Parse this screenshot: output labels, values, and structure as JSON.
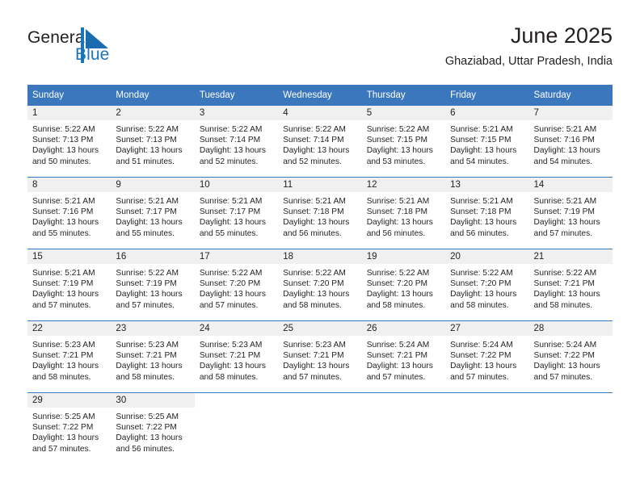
{
  "brand": {
    "name_part1": "General",
    "name_part2": "Blue",
    "flag_icon": "blue-flag-triangle-icon",
    "color_primary": "#1b75bb",
    "color_text": "#231f20"
  },
  "header": {
    "title": "June 2025",
    "subtitle": "Ghaziabad, Uttar Pradesh, India"
  },
  "theme": {
    "header_bg": "#3b77bc",
    "header_text": "#ffffff",
    "daynum_band_bg": "#f0f0f0",
    "cell_bg": "#ffffff",
    "row_separator": "#3b77bc"
  },
  "weekdays": [
    "Sunday",
    "Monday",
    "Tuesday",
    "Wednesday",
    "Thursday",
    "Friday",
    "Saturday"
  ],
  "weeks": [
    [
      {
        "day": "1",
        "sunrise": "Sunrise: 5:22 AM",
        "sunset": "Sunset: 7:13 PM",
        "daylight_line1": "Daylight: 13 hours",
        "daylight_line2": "and 50 minutes."
      },
      {
        "day": "2",
        "sunrise": "Sunrise: 5:22 AM",
        "sunset": "Sunset: 7:13 PM",
        "daylight_line1": "Daylight: 13 hours",
        "daylight_line2": "and 51 minutes."
      },
      {
        "day": "3",
        "sunrise": "Sunrise: 5:22 AM",
        "sunset": "Sunset: 7:14 PM",
        "daylight_line1": "Daylight: 13 hours",
        "daylight_line2": "and 52 minutes."
      },
      {
        "day": "4",
        "sunrise": "Sunrise: 5:22 AM",
        "sunset": "Sunset: 7:14 PM",
        "daylight_line1": "Daylight: 13 hours",
        "daylight_line2": "and 52 minutes."
      },
      {
        "day": "5",
        "sunrise": "Sunrise: 5:22 AM",
        "sunset": "Sunset: 7:15 PM",
        "daylight_line1": "Daylight: 13 hours",
        "daylight_line2": "and 53 minutes."
      },
      {
        "day": "6",
        "sunrise": "Sunrise: 5:21 AM",
        "sunset": "Sunset: 7:15 PM",
        "daylight_line1": "Daylight: 13 hours",
        "daylight_line2": "and 54 minutes."
      },
      {
        "day": "7",
        "sunrise": "Sunrise: 5:21 AM",
        "sunset": "Sunset: 7:16 PM",
        "daylight_line1": "Daylight: 13 hours",
        "daylight_line2": "and 54 minutes."
      }
    ],
    [
      {
        "day": "8",
        "sunrise": "Sunrise: 5:21 AM",
        "sunset": "Sunset: 7:16 PM",
        "daylight_line1": "Daylight: 13 hours",
        "daylight_line2": "and 55 minutes."
      },
      {
        "day": "9",
        "sunrise": "Sunrise: 5:21 AM",
        "sunset": "Sunset: 7:17 PM",
        "daylight_line1": "Daylight: 13 hours",
        "daylight_line2": "and 55 minutes."
      },
      {
        "day": "10",
        "sunrise": "Sunrise: 5:21 AM",
        "sunset": "Sunset: 7:17 PM",
        "daylight_line1": "Daylight: 13 hours",
        "daylight_line2": "and 55 minutes."
      },
      {
        "day": "11",
        "sunrise": "Sunrise: 5:21 AM",
        "sunset": "Sunset: 7:18 PM",
        "daylight_line1": "Daylight: 13 hours",
        "daylight_line2": "and 56 minutes."
      },
      {
        "day": "12",
        "sunrise": "Sunrise: 5:21 AM",
        "sunset": "Sunset: 7:18 PM",
        "daylight_line1": "Daylight: 13 hours",
        "daylight_line2": "and 56 minutes."
      },
      {
        "day": "13",
        "sunrise": "Sunrise: 5:21 AM",
        "sunset": "Sunset: 7:18 PM",
        "daylight_line1": "Daylight: 13 hours",
        "daylight_line2": "and 56 minutes."
      },
      {
        "day": "14",
        "sunrise": "Sunrise: 5:21 AM",
        "sunset": "Sunset: 7:19 PM",
        "daylight_line1": "Daylight: 13 hours",
        "daylight_line2": "and 57 minutes."
      }
    ],
    [
      {
        "day": "15",
        "sunrise": "Sunrise: 5:21 AM",
        "sunset": "Sunset: 7:19 PM",
        "daylight_line1": "Daylight: 13 hours",
        "daylight_line2": "and 57 minutes."
      },
      {
        "day": "16",
        "sunrise": "Sunrise: 5:22 AM",
        "sunset": "Sunset: 7:19 PM",
        "daylight_line1": "Daylight: 13 hours",
        "daylight_line2": "and 57 minutes."
      },
      {
        "day": "17",
        "sunrise": "Sunrise: 5:22 AM",
        "sunset": "Sunset: 7:20 PM",
        "daylight_line1": "Daylight: 13 hours",
        "daylight_line2": "and 57 minutes."
      },
      {
        "day": "18",
        "sunrise": "Sunrise: 5:22 AM",
        "sunset": "Sunset: 7:20 PM",
        "daylight_line1": "Daylight: 13 hours",
        "daylight_line2": "and 58 minutes."
      },
      {
        "day": "19",
        "sunrise": "Sunrise: 5:22 AM",
        "sunset": "Sunset: 7:20 PM",
        "daylight_line1": "Daylight: 13 hours",
        "daylight_line2": "and 58 minutes."
      },
      {
        "day": "20",
        "sunrise": "Sunrise: 5:22 AM",
        "sunset": "Sunset: 7:20 PM",
        "daylight_line1": "Daylight: 13 hours",
        "daylight_line2": "and 58 minutes."
      },
      {
        "day": "21",
        "sunrise": "Sunrise: 5:22 AM",
        "sunset": "Sunset: 7:21 PM",
        "daylight_line1": "Daylight: 13 hours",
        "daylight_line2": "and 58 minutes."
      }
    ],
    [
      {
        "day": "22",
        "sunrise": "Sunrise: 5:23 AM",
        "sunset": "Sunset: 7:21 PM",
        "daylight_line1": "Daylight: 13 hours",
        "daylight_line2": "and 58 minutes."
      },
      {
        "day": "23",
        "sunrise": "Sunrise: 5:23 AM",
        "sunset": "Sunset: 7:21 PM",
        "daylight_line1": "Daylight: 13 hours",
        "daylight_line2": "and 58 minutes."
      },
      {
        "day": "24",
        "sunrise": "Sunrise: 5:23 AM",
        "sunset": "Sunset: 7:21 PM",
        "daylight_line1": "Daylight: 13 hours",
        "daylight_line2": "and 58 minutes."
      },
      {
        "day": "25",
        "sunrise": "Sunrise: 5:23 AM",
        "sunset": "Sunset: 7:21 PM",
        "daylight_line1": "Daylight: 13 hours",
        "daylight_line2": "and 57 minutes."
      },
      {
        "day": "26",
        "sunrise": "Sunrise: 5:24 AM",
        "sunset": "Sunset: 7:21 PM",
        "daylight_line1": "Daylight: 13 hours",
        "daylight_line2": "and 57 minutes."
      },
      {
        "day": "27",
        "sunrise": "Sunrise: 5:24 AM",
        "sunset": "Sunset: 7:22 PM",
        "daylight_line1": "Daylight: 13 hours",
        "daylight_line2": "and 57 minutes."
      },
      {
        "day": "28",
        "sunrise": "Sunrise: 5:24 AM",
        "sunset": "Sunset: 7:22 PM",
        "daylight_line1": "Daylight: 13 hours",
        "daylight_line2": "and 57 minutes."
      }
    ],
    [
      {
        "day": "29",
        "sunrise": "Sunrise: 5:25 AM",
        "sunset": "Sunset: 7:22 PM",
        "daylight_line1": "Daylight: 13 hours",
        "daylight_line2": "and 57 minutes."
      },
      {
        "day": "30",
        "sunrise": "Sunrise: 5:25 AM",
        "sunset": "Sunset: 7:22 PM",
        "daylight_line1": "Daylight: 13 hours",
        "daylight_line2": "and 56 minutes."
      },
      {
        "day": "",
        "sunrise": "",
        "sunset": "",
        "daylight_line1": "",
        "daylight_line2": ""
      },
      {
        "day": "",
        "sunrise": "",
        "sunset": "",
        "daylight_line1": "",
        "daylight_line2": ""
      },
      {
        "day": "",
        "sunrise": "",
        "sunset": "",
        "daylight_line1": "",
        "daylight_line2": ""
      },
      {
        "day": "",
        "sunrise": "",
        "sunset": "",
        "daylight_line1": "",
        "daylight_line2": ""
      },
      {
        "day": "",
        "sunrise": "",
        "sunset": "",
        "daylight_line1": "",
        "daylight_line2": ""
      }
    ]
  ]
}
